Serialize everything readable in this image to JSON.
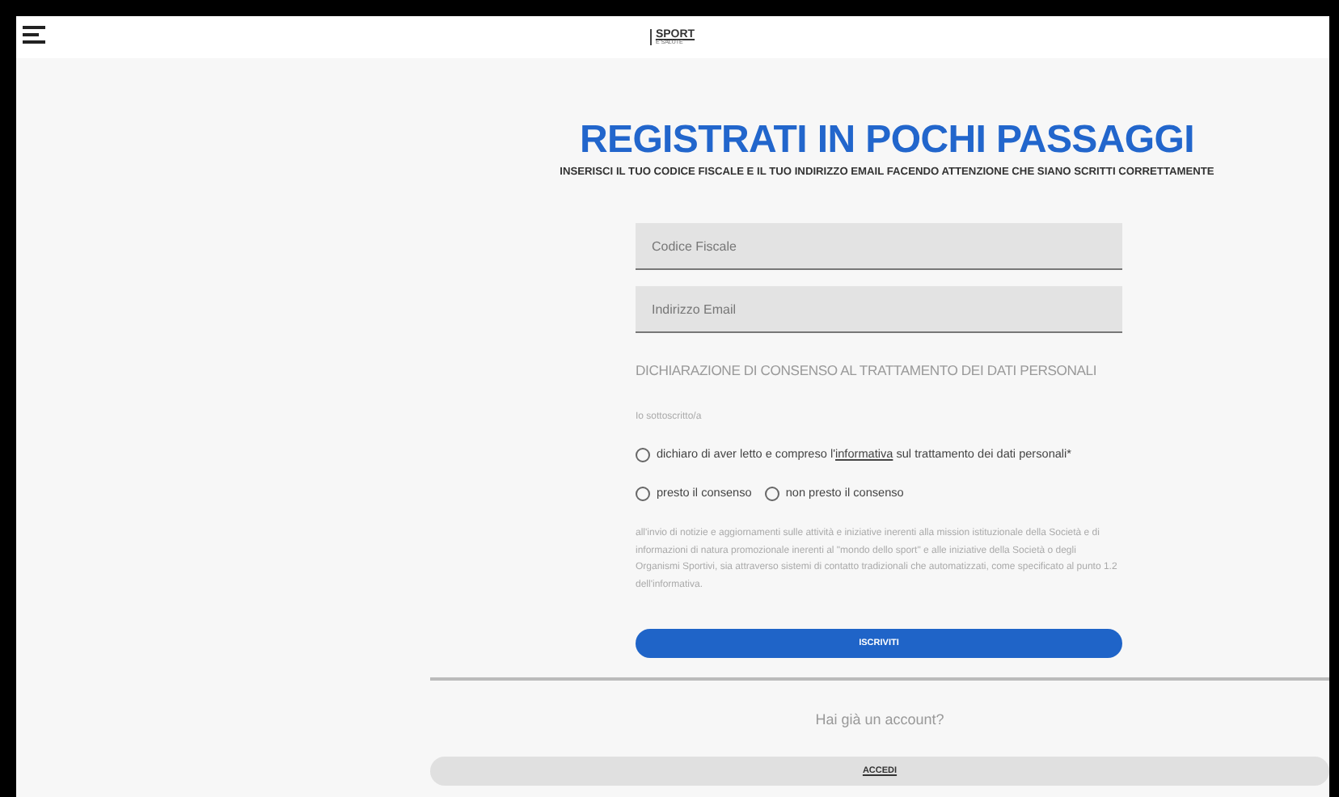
{
  "header": {
    "logo_top": "SPORT",
    "logo_bottom": "E SALUTE"
  },
  "title": "REGISTRATI IN POCHI PASSAGGI",
  "subtitle": "INSERISCI IL TUO CODICE FISCALE E IL TUO INDIRIZZO EMAIL FACENDO ATTENZIONE CHE SIANO SCRITTI CORRETTAMENTE",
  "fields": [
    {
      "placeholder": "Codice Fiscale"
    },
    {
      "placeholder": "Indirizzo Email"
    }
  ],
  "consent_heading": "DICHIARAZIONE DI CONSENSO AL TRATTAMENTO DEI DATI PERSONALI",
  "undersigned": "Io sottoscritto/a",
  "declaration": {
    "text_before": "dichiaro di aver letto e compreso l'",
    "link": "informativa",
    "text_after": " sul trattamento dei dati personali*",
    "checked": false
  },
  "consent_options": [
    {
      "label": "presto il consenso",
      "selected": false
    },
    {
      "label": "non presto il consenso",
      "selected": false
    }
  ],
  "consent_text": "all'invio di notizie e aggiornamenti sulle attività e iniziative inerenti alla mission istituzionale della Società e di informazioni di natura promozionale inerenti al \"mondo dello sport\" e alle iniziative della Società o degli Organismi Sportivi, sia attraverso sistemi di contatto tradizionali che automatizzati, come specificato al punto 1.2 dell'informativa.",
  "submit_button": "ISCRIVITI",
  "login_prompt": "Hai già un account?",
  "login_button": "ACCEDI"
}
